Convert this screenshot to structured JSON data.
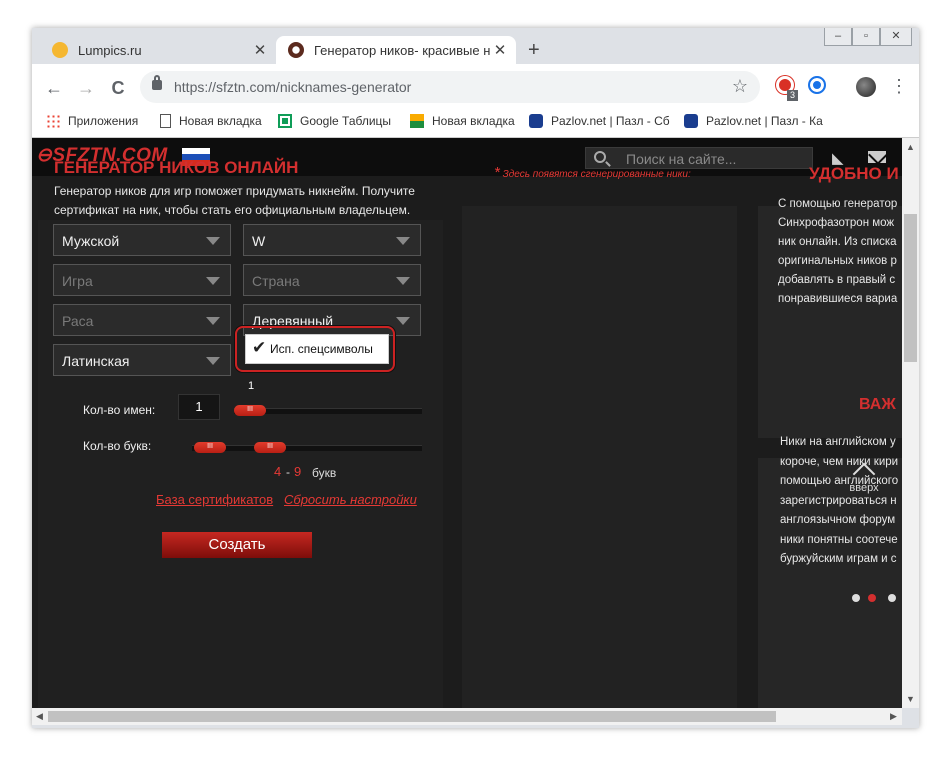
{
  "browser": {
    "tabs": [
      {
        "title": "Lumpics.ru",
        "favicon_color": "#f5b731"
      },
      {
        "title": "Генератор ников- красивые ни",
        "favicon_color": "#5c2a1e"
      }
    ],
    "new_tab_label": "+",
    "close_label": "✕",
    "window_controls": [
      "‒",
      "▫",
      "✕"
    ],
    "nav": {
      "back": "←",
      "forward": "→",
      "reload": "C"
    },
    "url": "https://sfztn.com/nicknames-generator",
    "star": "☆",
    "extension_badge": "3",
    "menu": "⋮",
    "bookmarks": [
      {
        "label": "Приложения",
        "icon": "apps-grid-icon"
      },
      {
        "label": "Новая вкладка",
        "icon": "page-icon"
      },
      {
        "label": "Google Таблицы",
        "icon": "sheets-icon"
      },
      {
        "label": "Новая вкладка",
        "icon": "image-icon"
      },
      {
        "label": "Pazlov.net | Пазл - Сб",
        "icon": "puzzle-icon"
      },
      {
        "label": "Pazlov.net | Пазл - Ка",
        "icon": "puzzle-icon"
      }
    ]
  },
  "site": {
    "logo": "SFZTN.COM",
    "search_placeholder": "Поиск на сайте...",
    "accent": "#d32f2f"
  },
  "generator": {
    "title": "ГЕНЕРАТОР НИКОВ ОНЛАЙН",
    "description": "Генератор ников для игр поможет придумать никнейм. Получите сертификат на ник, чтобы стать его официальным владельцем.",
    "dropdowns": {
      "gender": "Мужской",
      "letter": "W",
      "game": "Игра",
      "country": "Страна",
      "race": "Раса",
      "style": "Деревянный",
      "alphabet": "Латинская"
    },
    "special_chars": {
      "label": "Исп. спецсимволы",
      "checked": true,
      "mark": "✔"
    },
    "count_label": "Кол-во имен:",
    "count_value": "1",
    "count_slider_value": "1",
    "letters_label": "Кол-во букв:",
    "letters_min": "4",
    "letters_dash": "-",
    "letters_max": "9",
    "letters_unit": "букв",
    "handle_grip": "III",
    "link_certificates": "База сертификатов",
    "link_reset": "Сбросить настройки",
    "create_button": "Создать"
  },
  "results": {
    "asterisk": "*",
    "note": "Здесь появятся сгенерированные ники:"
  },
  "sidebar": {
    "title1": "УДОБНО И",
    "text1": [
      "С помощью генератор",
      "Синхрофазотрон мож",
      "ник онлайн. Из списка",
      "оригинальных ников р",
      "добавлять в правый с",
      "понравившиеся вариа"
    ],
    "title2": "ВАЖ",
    "text2": [
      "Ники на английском у",
      "короче, чем ники кири",
      "помощью английского",
      "зарегистрироваться н",
      "англоязычном форум",
      "ники понятны соотече",
      "буржуйским играм и с"
    ],
    "up_label": "вверх",
    "carousel_active": 1
  }
}
